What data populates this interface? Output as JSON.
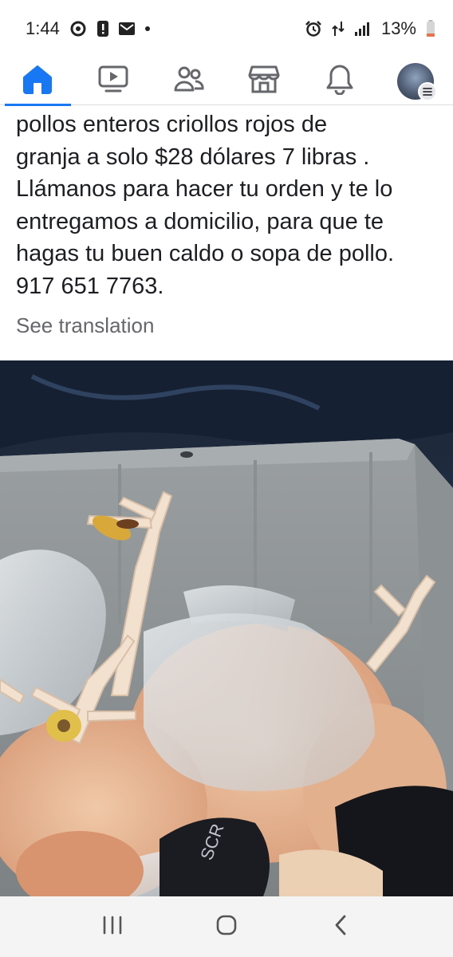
{
  "status_bar": {
    "time": "1:44",
    "battery": "13%"
  },
  "nav": {
    "items": [
      "home-icon",
      "video-icon",
      "friends-icon",
      "marketplace-icon",
      "notifications-icon",
      "profile-avatar"
    ],
    "active": "home"
  },
  "post": {
    "lines": [
      "pollos enteros criollos rojos de",
      "granja a solo $28 dólares 7 libras .",
      "Llámanos para hacer tu orden y te lo",
      "entregamos a domicilio, para que te",
      "hagas tu buen caldo o sopa de pollo.",
      "917 651 7763."
    ],
    "see_translation": "See translation"
  },
  "photo": {
    "bag_label": "SCR"
  },
  "colors": {
    "accent": "#1877f2",
    "text": "#1c1e21",
    "muted": "#65676b"
  }
}
